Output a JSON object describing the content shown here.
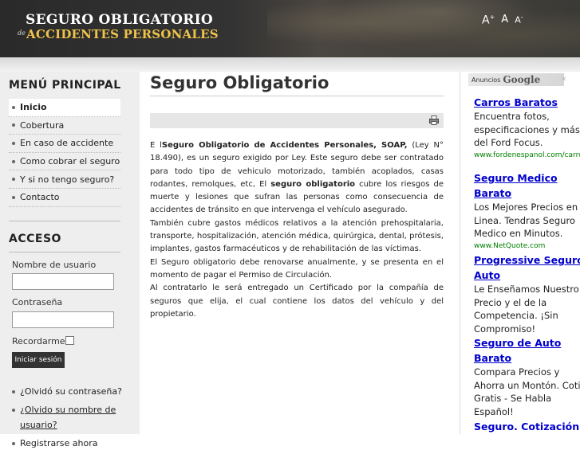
{
  "header": {
    "logo_line1": "SEGURO OBLIGATORIO",
    "logo_de": "de",
    "logo_line2": "ACCIDENTES PERSONALES",
    "font_larger": "A",
    "font_larger_sup": "+",
    "font_reset": "A",
    "font_smaller": "A",
    "font_smaller_sup": "-"
  },
  "sidebar": {
    "menu_title": "MENÚ PRINCIPAL",
    "menu_items": [
      {
        "label": "Inicio"
      },
      {
        "label": "Cobertura"
      },
      {
        "label": "En caso de accidente"
      },
      {
        "label": "Como cobrar el seguro"
      },
      {
        "label": "Y si no tengo seguro?"
      },
      {
        "label": "Contacto"
      }
    ],
    "access_title": "ACCESO",
    "username_label": "Nombre de usuario",
    "password_label": "Contraseña",
    "remember_label": "Recordarme",
    "login_button": "Iniciar sesión",
    "links": [
      {
        "label": "¿Olvidó su contraseña?"
      },
      {
        "label": "¿Olvido su nombre de usuario?"
      },
      {
        "label": "Registrarse ahora"
      }
    ]
  },
  "main": {
    "title": "Seguro Obligatorio",
    "p1_a": "E l",
    "p1_b": "Seguro Obligatorio de Accidentes Personales, SOAP,",
    "p1_c": "(Ley N° 18.490), es un seguro exigido por Ley. Este seguro debe ser contratado para todo tipo de vehiculo motorizado, también acoplados, casas rodantes, remolques, etc, El",
    "p1_d": "seguro obligatorio",
    "p1_e": "cubre los riesgos de muerte y lesiones que sufran las personas como consecuencia de accidentes de tránsito en que intervenga el vehículo asegurado.",
    "p2": "También cubre gastos médicos relativos a la atención prehospitalaria, transporte, hospitalización, atención médica, quirúrgica, dental, prótesis, implantes, gastos farmacéuticos y de rehabilitación de las víctimas.",
    "p3": "El Seguro obligatorio debe renovarse anualmente, y se presenta en el momento de pagar el Permiso de Circulación.",
    "p4": "Al contratarlo le será entregado un Certificado por la compañía de seguros que elija, el cual contiene los datos del vehículo y del propietario."
  },
  "ads": {
    "header_by": "Anuncios",
    "header_brand": "Google",
    "close": "✕",
    "items": [
      {
        "title": "Carros Baratos",
        "lines": [
          "Encuentra fotos,",
          "especificaciones y más",
          "del Ford Focus."
        ],
        "url": "www.fordenespanol.com/carros"
      },
      {
        "title": "Seguro Medico",
        "title2": "Barato",
        "lines": [
          "Los Mejores Precios en",
          "Linea. Tendras Seguro",
          "Medico en Minutos."
        ],
        "url": "www.NetQuote.com"
      },
      {
        "title": "Progressive Seguro",
        "title2": "Auto",
        "lines": [
          "Le Enseñamos Nuestro",
          "Precio y el de la",
          "Competencia. ¡Sin",
          "Compromiso!"
        ],
        "url": ""
      },
      {
        "title": "Seguro de Auto",
        "title2": "Barato",
        "lines": [
          "Compara Precios y",
          "Ahorra un Montón. Coti",
          "Gratis - Se Habla",
          "Español!"
        ],
        "url": ""
      },
      {
        "title": "Seguro. Cotización",
        "lines": [],
        "url": ""
      }
    ]
  }
}
